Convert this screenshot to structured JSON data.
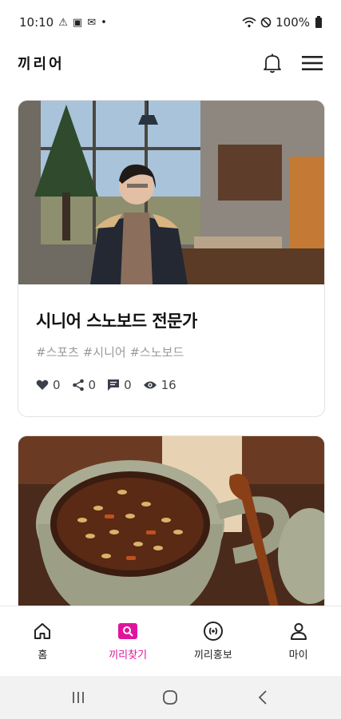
{
  "status_bar": {
    "time": "10:10",
    "battery": "100%"
  },
  "header": {
    "logo": "끼리어"
  },
  "posts": [
    {
      "title": "시니어 스노보드 전문가",
      "tags": "#스포츠 #시니어 #스노보드",
      "likes": "0",
      "shares": "0",
      "comments": "0",
      "views": "16"
    },
    {
      "title": "",
      "tags": ""
    }
  ],
  "bottom_nav": {
    "items": [
      {
        "label": "홈",
        "icon": "home-icon"
      },
      {
        "label": "끼리찾기",
        "icon": "search-icon"
      },
      {
        "label": "끼리홍보",
        "icon": "broadcast-icon"
      },
      {
        "label": "마이",
        "icon": "person-icon"
      }
    ],
    "active_color": "#e0149c"
  }
}
